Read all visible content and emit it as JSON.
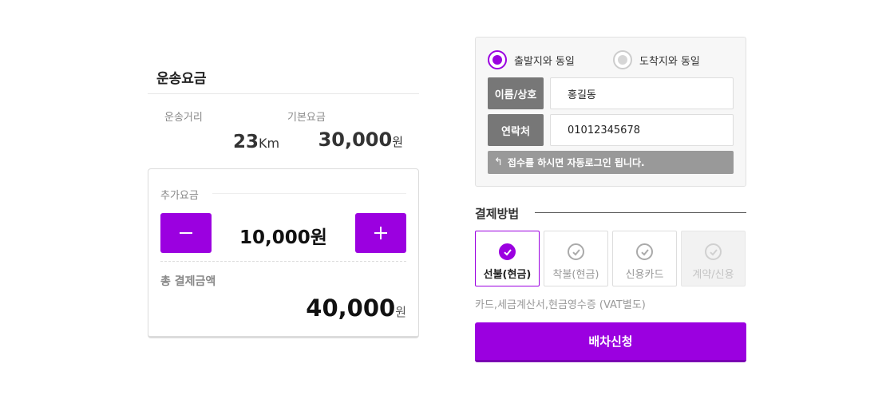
{
  "fare": {
    "title": "운송요금",
    "distance_label": "운송거리",
    "base_label": "기본요금",
    "distance_value": "23",
    "distance_unit": "Km",
    "base_value": "30,000",
    "base_unit": "원"
  },
  "extra": {
    "label": "추가요금",
    "minus_icon": "minus-icon",
    "plus_icon": "plus-icon",
    "amount": "10,000원",
    "total_label": "총 결제금액",
    "total_value": "40,000",
    "total_unit": "원"
  },
  "receiver": {
    "radio_same_origin": "출발지와 동일",
    "radio_same_dest": "도착지와 동일",
    "selected_radio": "출발지와 동일",
    "name_label": "이름/상호",
    "name_value": "홍길동",
    "phone_label": "연락처",
    "phone_value": "01012345678",
    "notice": "접수를 하시면 자동로그인 됩니다.",
    "notice_icon": "arrow-up-icon"
  },
  "payment": {
    "title": "결제방법",
    "options": [
      {
        "label": "선불(현금)",
        "state": "selected"
      },
      {
        "label": "착불(현금)",
        "state": "normal"
      },
      {
        "label": "신용카드",
        "state": "normal"
      },
      {
        "label": "계약/신용",
        "state": "disabled"
      }
    ],
    "note": "카드,세금계산서,현금영수증 (VAT별도)",
    "icon": "check-circle-icon"
  },
  "submit_label": "배차신청",
  "colors": {
    "accent": "#9b00e0",
    "label_bg": "#777777",
    "notice_bg": "#999999"
  }
}
